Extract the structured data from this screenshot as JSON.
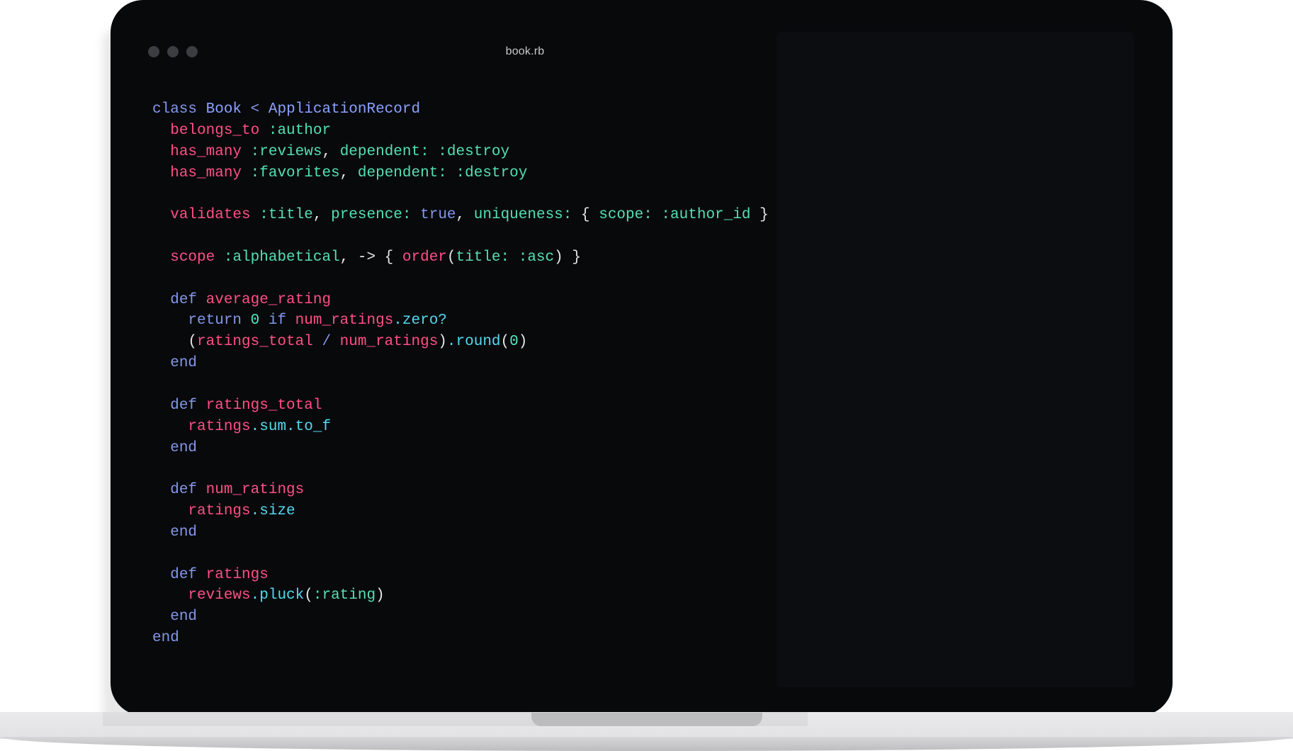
{
  "window": {
    "title": "book.rb"
  },
  "code_lines": [
    [
      [
        "kw",
        "class "
      ],
      [
        "cn",
        "Book "
      ],
      [
        "kw",
        "< "
      ],
      [
        "cn",
        "ApplicationRecord"
      ]
    ],
    [
      [
        "pl",
        "  "
      ],
      [
        "fn",
        "belongs_to "
      ],
      [
        "sym",
        ":author"
      ]
    ],
    [
      [
        "pl",
        "  "
      ],
      [
        "fn",
        "has_many "
      ],
      [
        "sym",
        ":reviews"
      ],
      [
        "pl",
        ", "
      ],
      [
        "sym",
        "dependent: :destroy"
      ]
    ],
    [
      [
        "pl",
        "  "
      ],
      [
        "fn",
        "has_many "
      ],
      [
        "sym",
        ":favorites"
      ],
      [
        "pl",
        ", "
      ],
      [
        "sym",
        "dependent: :destroy"
      ]
    ],
    [],
    [
      [
        "pl",
        "  "
      ],
      [
        "fn",
        "validates "
      ],
      [
        "sym",
        ":title"
      ],
      [
        "pl",
        ", "
      ],
      [
        "sym",
        "presence: "
      ],
      [
        "kw",
        "true"
      ],
      [
        "pl",
        ", "
      ],
      [
        "sym",
        "uniqueness: "
      ],
      [
        "pl",
        "{ "
      ],
      [
        "sym",
        "scope: :author_id "
      ],
      [
        "pl",
        "}"
      ]
    ],
    [],
    [
      [
        "pl",
        "  "
      ],
      [
        "fn",
        "scope "
      ],
      [
        "sym",
        ":alphabetical"
      ],
      [
        "pl",
        ", -> { "
      ],
      [
        "fn",
        "order"
      ],
      [
        "pl",
        "("
      ],
      [
        "sym",
        "title: :asc"
      ],
      [
        "pl",
        ") }"
      ]
    ],
    [],
    [
      [
        "pl",
        "  "
      ],
      [
        "kw",
        "def "
      ],
      [
        "fn",
        "average_rating"
      ]
    ],
    [
      [
        "pl",
        "    "
      ],
      [
        "kw",
        "return "
      ],
      [
        "num",
        "0 "
      ],
      [
        "kw",
        "if "
      ],
      [
        "fn",
        "num_ratings"
      ],
      [
        "mt",
        ".zero?"
      ]
    ],
    [
      [
        "pl",
        "    ("
      ],
      [
        "fn",
        "ratings_total "
      ],
      [
        "kw",
        "/ "
      ],
      [
        "fn",
        "num_ratings"
      ],
      [
        "pl",
        ")"
      ],
      [
        "mt",
        ".round"
      ],
      [
        "pl",
        "("
      ],
      [
        "num",
        "0"
      ],
      [
        "pl",
        ")"
      ]
    ],
    [
      [
        "pl",
        "  "
      ],
      [
        "kw",
        "end"
      ]
    ],
    [],
    [
      [
        "pl",
        "  "
      ],
      [
        "kw",
        "def "
      ],
      [
        "fn",
        "ratings_total"
      ]
    ],
    [
      [
        "pl",
        "    "
      ],
      [
        "fn",
        "ratings"
      ],
      [
        "mt",
        ".sum.to_f"
      ]
    ],
    [
      [
        "pl",
        "  "
      ],
      [
        "kw",
        "end"
      ]
    ],
    [],
    [
      [
        "pl",
        "  "
      ],
      [
        "kw",
        "def "
      ],
      [
        "fn",
        "num_ratings"
      ]
    ],
    [
      [
        "pl",
        "    "
      ],
      [
        "fn",
        "ratings"
      ],
      [
        "mt",
        ".size"
      ]
    ],
    [
      [
        "pl",
        "  "
      ],
      [
        "kw",
        "end"
      ]
    ],
    [],
    [
      [
        "pl",
        "  "
      ],
      [
        "kw",
        "def "
      ],
      [
        "fn",
        "ratings"
      ]
    ],
    [
      [
        "pl",
        "    "
      ],
      [
        "fn",
        "reviews"
      ],
      [
        "mt",
        ".pluck"
      ],
      [
        "pl",
        "("
      ],
      [
        "sym",
        ":rating"
      ],
      [
        "pl",
        ")"
      ]
    ],
    [
      [
        "pl",
        "  "
      ],
      [
        "kw",
        "end"
      ]
    ],
    [
      [
        "kw",
        "end"
      ]
    ]
  ],
  "colors": {
    "screen_bg": "#08090b",
    "keyword": "#8497e9",
    "constant": "#8aa0ff",
    "method": "#ff4f86",
    "symbol": "#54e0b0",
    "number": "#55e8c4",
    "chained_method": "#55d8f0",
    "plain": "#e6e6e6"
  }
}
